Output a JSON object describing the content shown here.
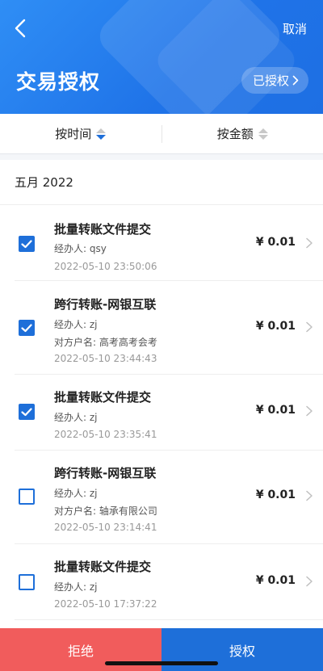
{
  "header": {
    "cancel_label": "取消",
    "title": "交易授权",
    "authorized_label": "已授权"
  },
  "sort": {
    "by_time_label": "按时间",
    "by_amount_label": "按金额"
  },
  "list": {
    "month_label": "五月 2022",
    "transactions": [
      {
        "checked": true,
        "title": "批量转账文件提交",
        "handler": "经办人: qsy",
        "counterparty": "",
        "datetime": "2022-05-10 23:50:06",
        "amount": "¥ 0.01"
      },
      {
        "checked": true,
        "title": "跨行转账-网银互联",
        "handler": "经办人: zj",
        "counterparty": "对方户名: 高考高考会考",
        "datetime": "2022-05-10 23:44:43",
        "amount": "¥ 0.01"
      },
      {
        "checked": true,
        "title": "批量转账文件提交",
        "handler": "经办人: zj",
        "counterparty": "",
        "datetime": "2022-05-10 23:35:41",
        "amount": "¥ 0.01"
      },
      {
        "checked": false,
        "title": "跨行转账-网银互联",
        "handler": "经办人: zj",
        "counterparty": "对方户名: 轴承有限公司",
        "datetime": "2022-05-10 23:14:41",
        "amount": "¥ 0.01"
      },
      {
        "checked": false,
        "title": "批量转账文件提交",
        "handler": "经办人: zj",
        "counterparty": "",
        "datetime": "2022-05-10 17:37:22",
        "amount": "¥ 0.01"
      }
    ]
  },
  "actions": {
    "reject_label": "拒绝",
    "approve_label": "授权"
  },
  "colors": {
    "brand_blue": "#1e6fd9",
    "reject_red": "#f15c5c"
  }
}
